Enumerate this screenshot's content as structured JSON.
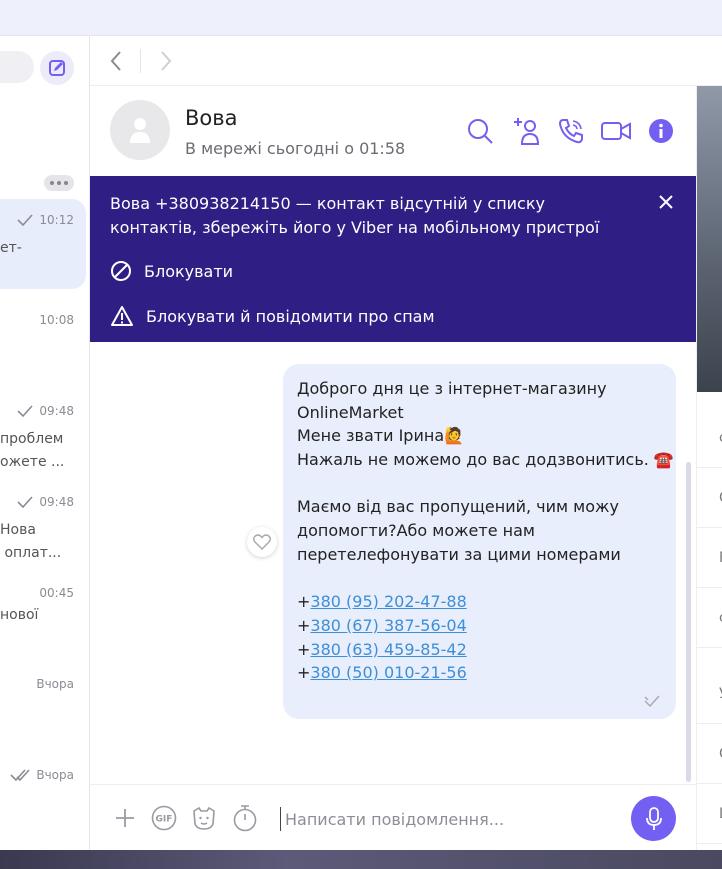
{
  "colors": {
    "accent": "#7360f2",
    "banner_bg": "#2f1f85",
    "bubble_bg": "#e8eefb",
    "link": "#3d8fd8"
  },
  "sidebar": {
    "chats": [
      {
        "time": "10:12",
        "snippet": "ет-",
        "status": "sent"
      },
      {
        "time": "10:08",
        "snippet": ""
      },
      {
        "time": "09:48",
        "snippet": "проблем\nожете ...",
        "status": "sent"
      },
      {
        "time": "09:48",
        "snippet": "Нова\n оплат...",
        "status": "sent"
      },
      {
        "time": "00:45",
        "snippet": "нової"
      },
      {
        "time": "Вчора",
        "snippet": ""
      },
      {
        "time": "Вчора",
        "snippet": "",
        "status": "read"
      }
    ]
  },
  "header": {
    "name": "Вова",
    "status": "В мережі сьогодні о 01:58",
    "icons": [
      "search-icon",
      "add-contact-icon",
      "phone-icon",
      "video-icon",
      "info-icon"
    ]
  },
  "banner": {
    "text": "Вова +380938214150 — контакт відсутній у списку контактів, збережіть його у Viber на мобільному пристрої",
    "block_label": "Блокувати",
    "block_report_label": "Блокувати й повідомити про спам"
  },
  "message": {
    "lines": [
      "Доброго дня це з інтернет-магазину",
      "OnlineMarket",
      "Мене звати Ірина🙋",
      "Нажаль не можемо до вас додзвонитись. ☎️",
      "",
      "Маємо від вас пропущений, чим можу",
      "допомогти?Або можете  нам",
      "перетелефонувати за цими номерами",
      ""
    ],
    "phones": [
      {
        "prefix": "+",
        "number": "380 (95) 202-47-88"
      },
      {
        "prefix": "+",
        "number": "380 (67) 387-56-04"
      },
      {
        "prefix": "+",
        "number": "380 (63) 459-85-42"
      },
      {
        "prefix": "+",
        "number": "380 (50) 010-21-56"
      }
    ]
  },
  "composer": {
    "placeholder": "Написати повідомлення..."
  },
  "right_panel": {
    "items": [
      "с",
      "С",
      "П",
      "с",
      "У",
      "С",
      "L"
    ]
  }
}
